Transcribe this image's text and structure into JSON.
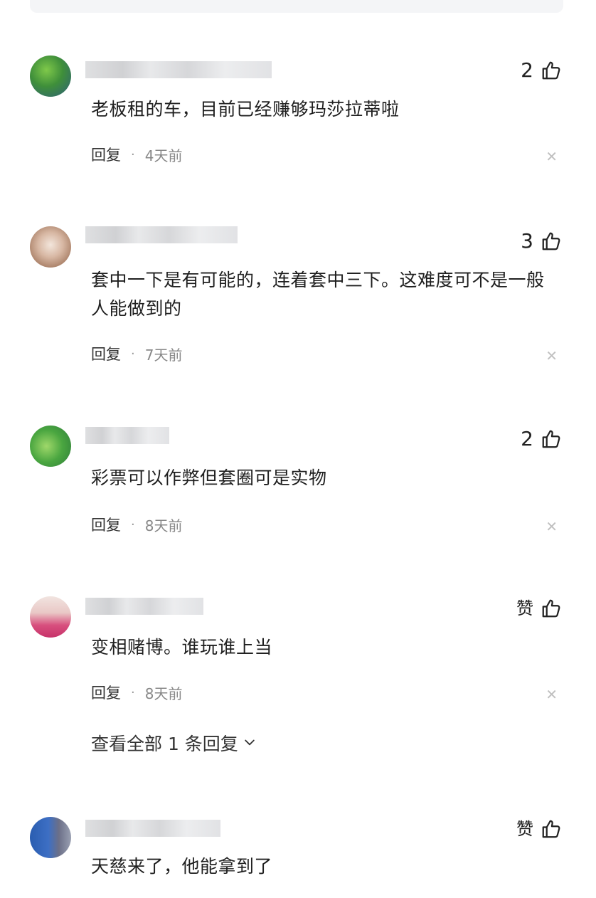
{
  "comments": [
    {
      "likes": "2",
      "text": "老板租的车，目前已经赚够玛莎拉蒂啦",
      "reply_label": "回复",
      "time": "4天前"
    },
    {
      "likes": "3",
      "text": "套中一下是有可能的，连着套中三下。这难度可不是一般人能做到的",
      "reply_label": "回复",
      "time": "7天前"
    },
    {
      "likes": "2",
      "text": "彩票可以作弊但套圈可是实物",
      "reply_label": "回复",
      "time": "8天前"
    },
    {
      "likes": "赞",
      "text": "变相赌博。谁玩谁上当",
      "reply_label": "回复",
      "time": "8天前",
      "view_replies": "查看全部 1 条回复"
    },
    {
      "likes": "赞",
      "text": "天慈来了，他能拿到了"
    }
  ],
  "colors": {
    "text": "#1f1f1f",
    "meta": "#888888",
    "close": "#c0c0c0"
  },
  "icons": {
    "like": "thumbs-up-icon",
    "close": "close-icon",
    "expand": "chevron-down-icon"
  }
}
